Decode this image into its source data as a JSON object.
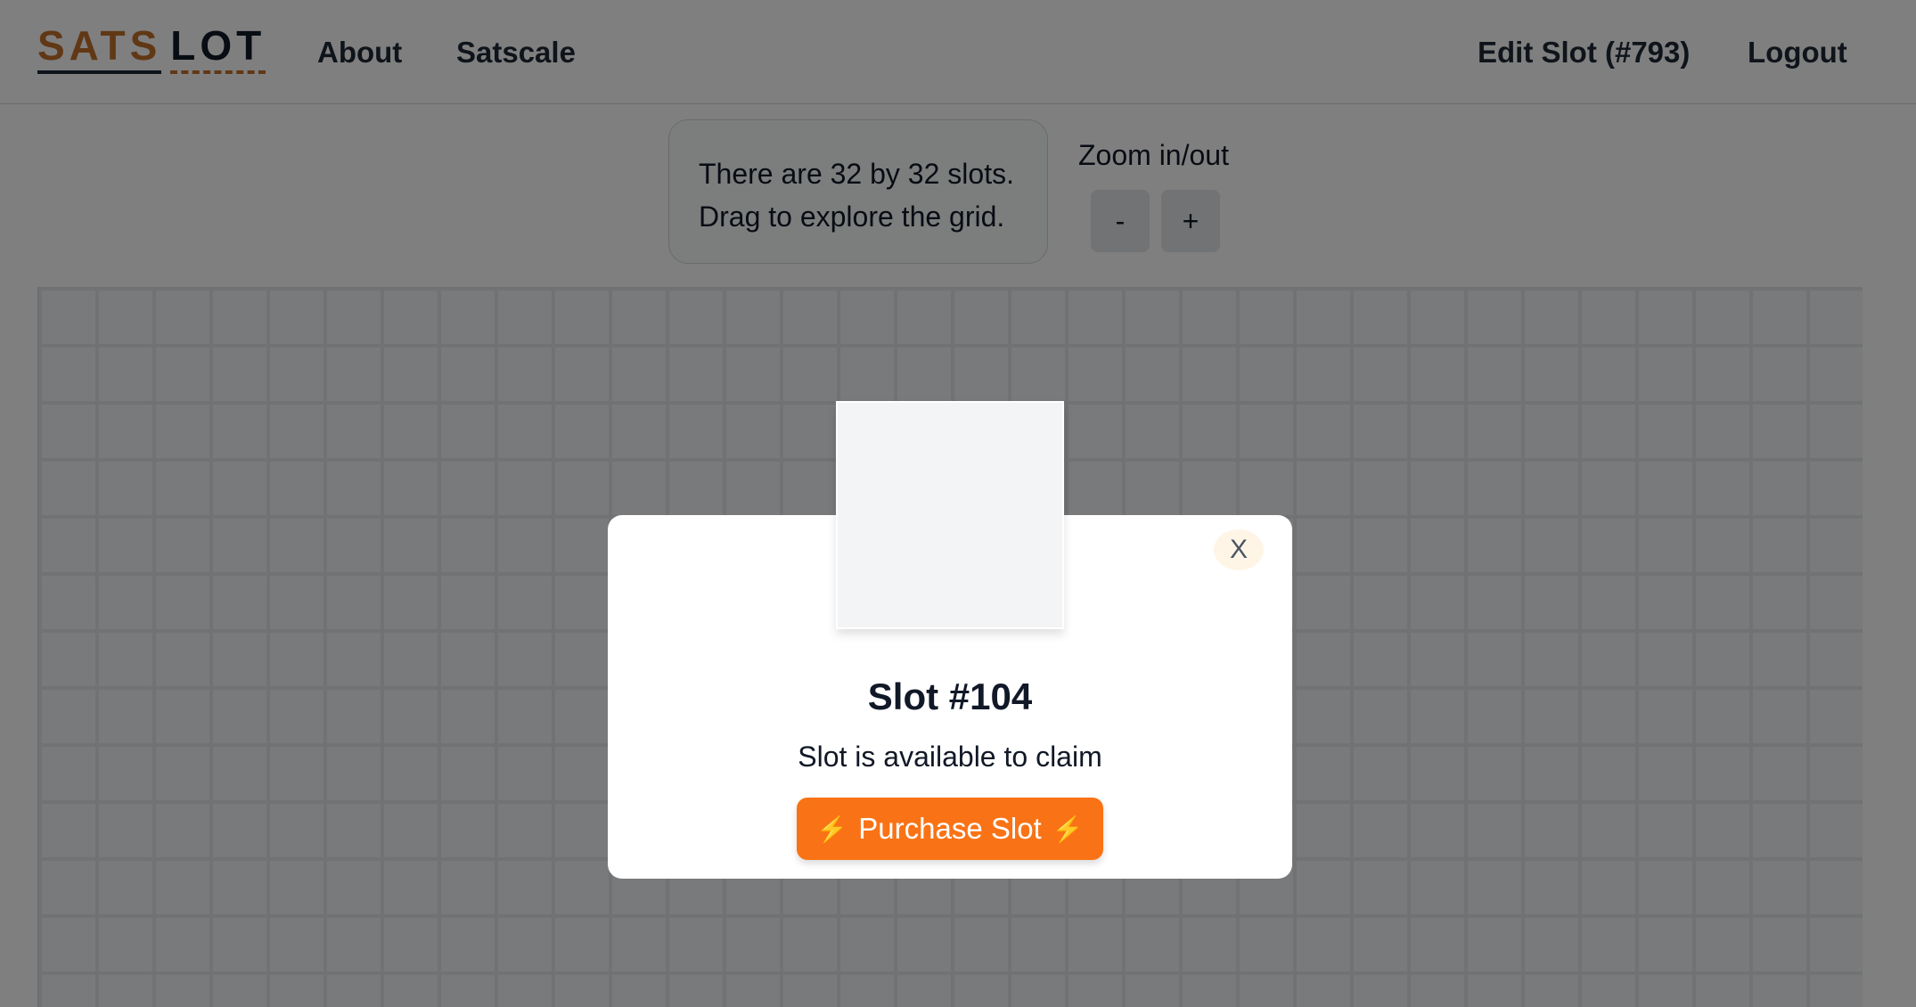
{
  "header": {
    "logo": {
      "part1": "SATS",
      "part2": "LOT"
    },
    "nav": {
      "about": "About",
      "satscale": "Satscale",
      "edit_slot": "Edit Slot (#793)",
      "logout": "Logout"
    }
  },
  "info": {
    "line1": "There are 32 by 32 slots.",
    "line2": "Drag to explore the grid."
  },
  "zoom": {
    "label": "Zoom in/out",
    "out_label": "-",
    "in_label": "+"
  },
  "modal": {
    "close_label": "X",
    "title": "Slot #104",
    "status": "Slot is available to claim",
    "purchase_label": "Purchase Slot",
    "bolt_icon": "⚡"
  },
  "colors": {
    "accent": "#f97316",
    "logo_brown": "#c2702a"
  }
}
